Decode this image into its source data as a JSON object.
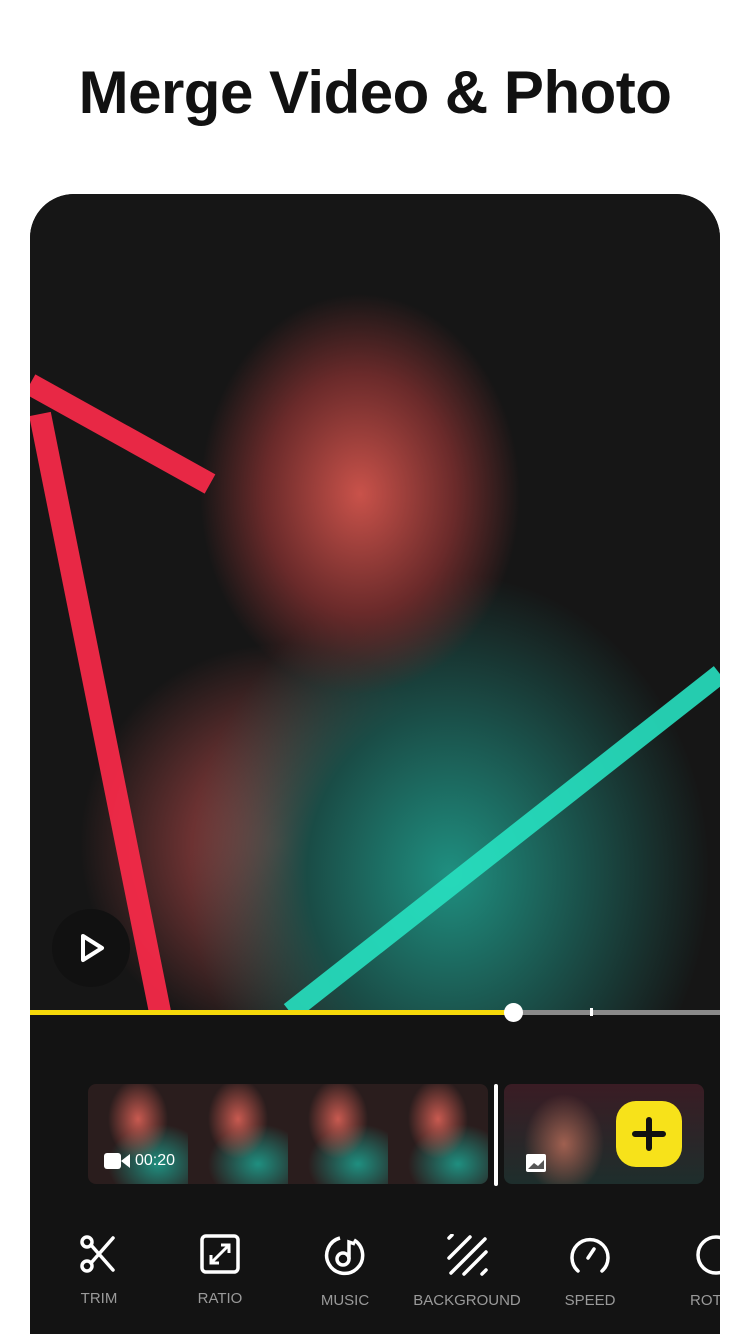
{
  "headline": "Merge Video & Photo",
  "player": {
    "progress": 0.7,
    "progress_color": "#f5d90a"
  },
  "timeline": {
    "clip1_duration": "00:20",
    "add_color": "#f7e21a"
  },
  "tools": [
    {
      "label": "TRIM",
      "icon": "scissors-icon"
    },
    {
      "label": "RATIO",
      "icon": "ratio-icon"
    },
    {
      "label": "MUSIC",
      "icon": "music-icon"
    },
    {
      "label": "BACKGROUND",
      "icon": "background-icon"
    },
    {
      "label": "SPEED",
      "icon": "speed-icon"
    },
    {
      "label": "ROT",
      "icon": "rotate-icon"
    }
  ]
}
